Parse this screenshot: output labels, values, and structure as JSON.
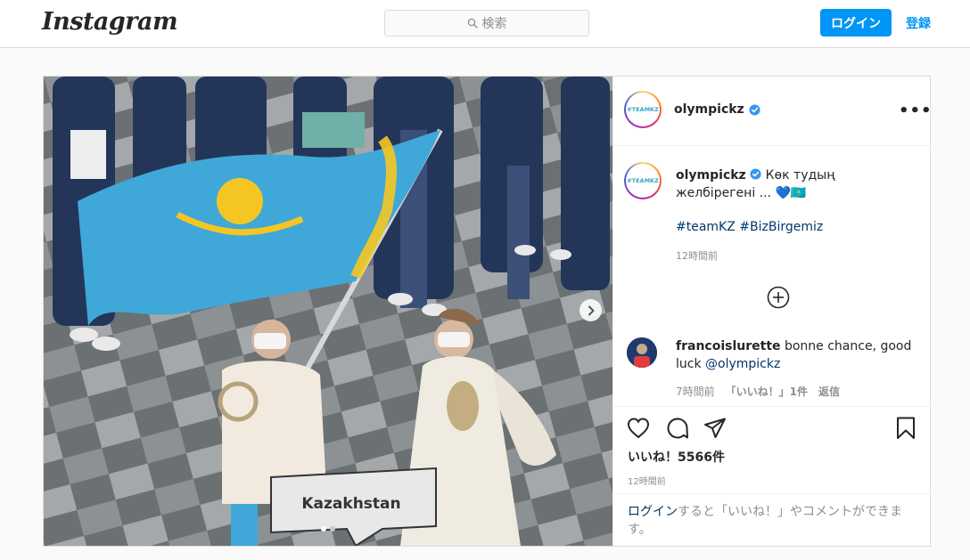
{
  "header": {
    "logo_text": "Instagram",
    "search_placeholder": "検索",
    "login_button": "ログイン",
    "signup_link": "登録"
  },
  "post": {
    "username": "olympickz",
    "verified": true,
    "avatar_text": "#TEAMKZ",
    "photo": {
      "sign_text": "Kazakhstan",
      "carousel_position": 1,
      "carousel_total": 2
    },
    "caption": {
      "username": "olympickz",
      "text": " Көк тудың желбірегені ... 💙🇰🇿",
      "hashtag_1": "#teamKZ",
      "hashtag_2": "#BizBirgemiz",
      "time": "12時間前"
    },
    "comment": {
      "username": "francoislurette",
      "text": " bonne chance, good luck ",
      "mention": "@olympickz",
      "time": "7時間前",
      "likes": "「いいね！」1件",
      "reply": "返信"
    },
    "likes": "いいね！5566件",
    "time": "12時間前",
    "login_prompt": {
      "link": "ログイン",
      "text": "すると「いいね！」やコメントができます。"
    }
  },
  "colors": {
    "accent": "#0095f6",
    "link_dark": "#00376b",
    "flag_blue": "#3fa8d8",
    "flag_gold": "#f5c623"
  }
}
